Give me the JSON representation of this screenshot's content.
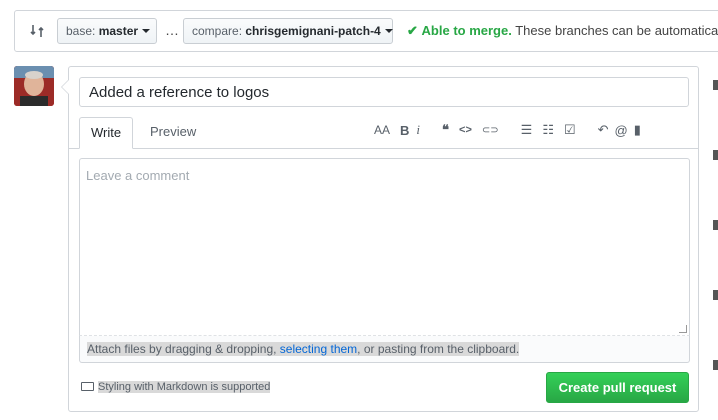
{
  "compare_bar": {
    "base_label": "base:",
    "base_value": "master",
    "dots": "…",
    "compare_label": "compare:",
    "compare_value": "chrisgemignani-patch-4",
    "merge_check": "✔",
    "merge_status": "Able to merge.",
    "merge_detail": "These branches can be automatica"
  },
  "pull_request": {
    "title_value": "Added a reference to logos",
    "tabs": [
      "Write",
      "Preview"
    ],
    "toolbar": {
      "header": "AA",
      "bold": "B",
      "italic": "i",
      "quote": "❝",
      "code": "<>",
      "link": "⊂⊃",
      "unordered_list": "☰",
      "ordered_list": "☷",
      "task_list": "☑",
      "reply": "↶",
      "mention": "@",
      "bookmark": "▮"
    },
    "comment_placeholder": "Leave a comment",
    "attach_text_1": "Attach files by dragging & dropping, ",
    "attach_link": "selecting them",
    "attach_text_2": ", or pasting from the clipboard.",
    "markdown_note": "Styling with Markdown is supported",
    "submit_label": "Create pull request"
  },
  "colors": {
    "success": "#28a745",
    "link": "#0366d6",
    "border": "#d1d5da"
  }
}
